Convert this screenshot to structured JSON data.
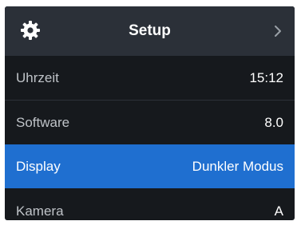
{
  "header": {
    "title": "Setup",
    "left_icon": "gear-icon",
    "right_icon": "chevron-right-icon"
  },
  "rows": [
    {
      "label": "Uhrzeit",
      "value": "15:12",
      "selected": false
    },
    {
      "label": "Software",
      "value": "8.0",
      "selected": false
    },
    {
      "label": "Display",
      "value": "Dunkler Modus",
      "selected": true
    },
    {
      "label": "Kamera",
      "value": "A",
      "selected": false
    }
  ],
  "colors": {
    "panel_background": "#16191d",
    "header_background": "#2b3038",
    "selection": "#1f6fd0",
    "label_text": "#bfc3c8",
    "value_text": "#ffffff"
  }
}
